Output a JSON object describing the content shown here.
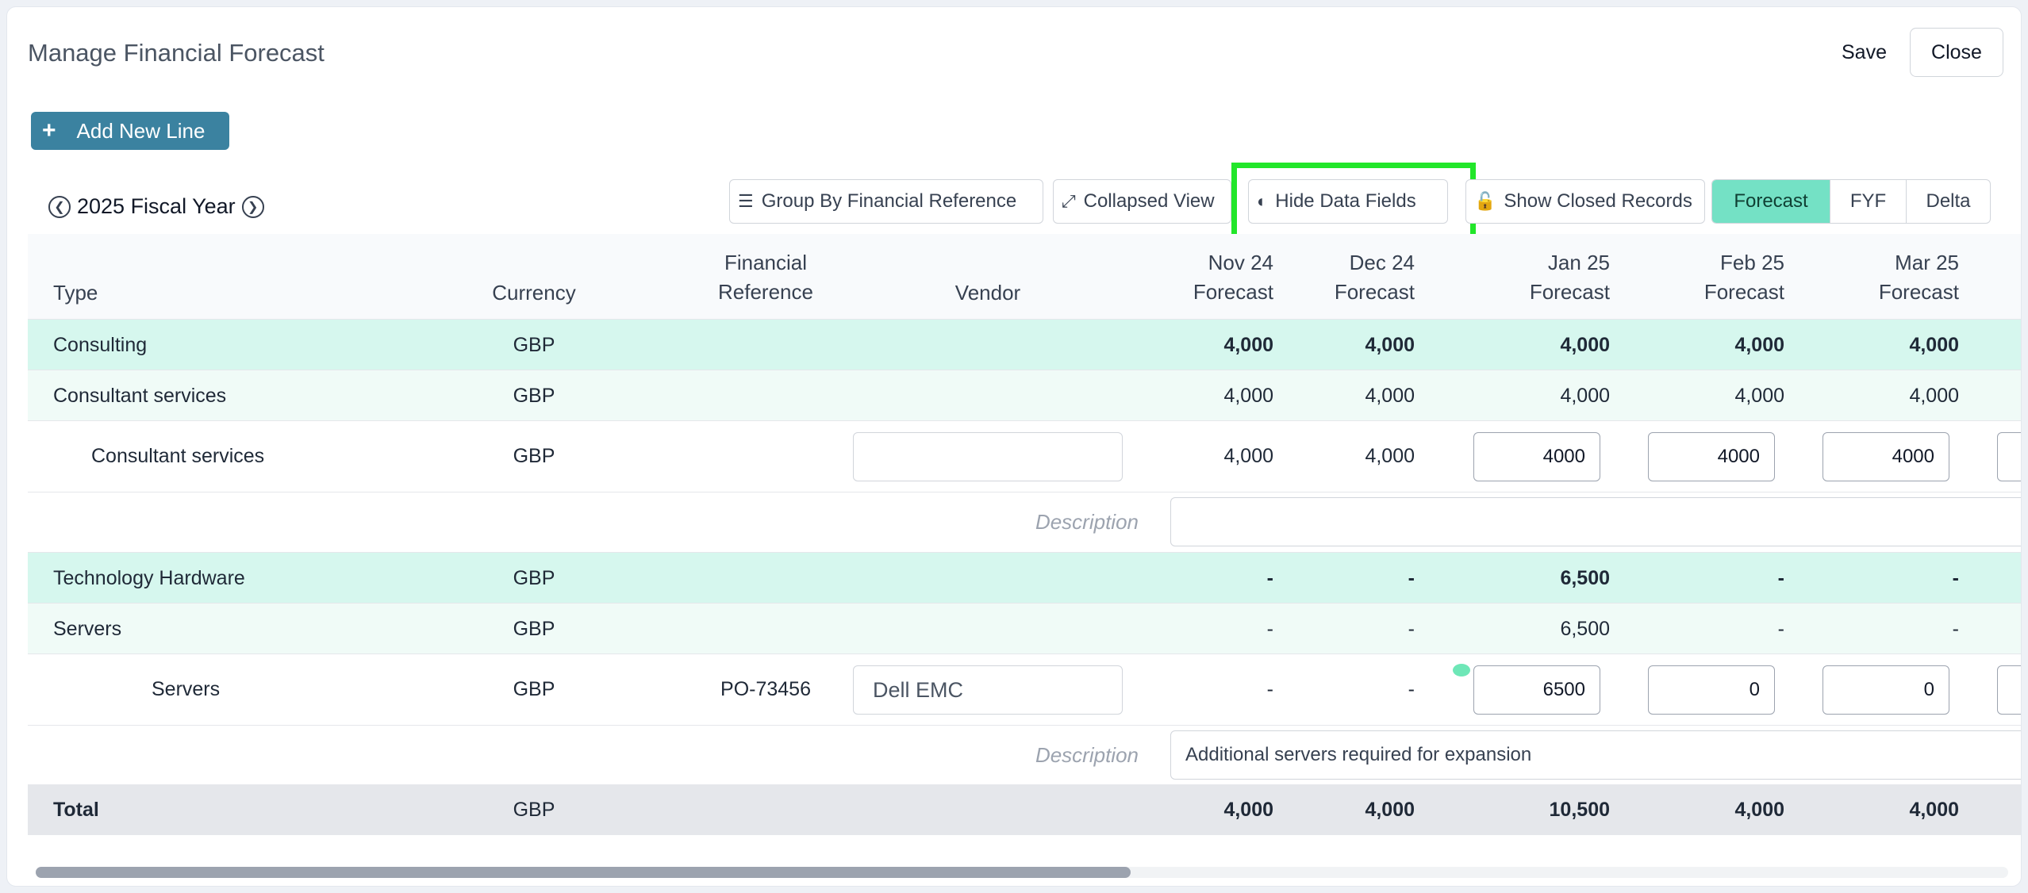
{
  "dialog": {
    "title": "Manage Financial Forecast",
    "save_label": "Save",
    "close_label": "Close"
  },
  "toolbar": {
    "add_line_label": "Add New Line",
    "fiscal_year_label": "2025 Fiscal Year",
    "group_by_label": "Group By Financial Reference",
    "collapsed_view_label": "Collapsed View",
    "hide_fields_label": "Hide Data Fields",
    "show_closed_label": "Show Closed Records",
    "view_modes": [
      "Forecast",
      "FYF",
      "Delta"
    ],
    "active_view": "Forecast"
  },
  "table": {
    "headers": {
      "type": "Type",
      "currency": "Currency",
      "fin_ref_1": "Financial",
      "fin_ref_2": "Reference",
      "vendor": "Vendor",
      "months": [
        {
          "m": "Nov 24",
          "sub": "Forecast"
        },
        {
          "m": "Dec 24",
          "sub": "Forecast"
        },
        {
          "m": "Jan 25",
          "sub": "Forecast"
        },
        {
          "m": "Feb 25",
          "sub": "Forecast"
        },
        {
          "m": "Mar 25",
          "sub": "Forecast"
        }
      ]
    },
    "rows": {
      "consulting": {
        "type": "Consulting",
        "currency": "GBP",
        "v": [
          "4,000",
          "4,000",
          "4,000",
          "4,000",
          "4,000"
        ]
      },
      "consultant_group": {
        "type": "Consultant services",
        "currency": "GBP",
        "v": [
          "4,000",
          "4,000",
          "4,000",
          "4,000",
          "4,000"
        ]
      },
      "consultant_line": {
        "type": "Consultant services",
        "currency": "GBP",
        "vendor": "",
        "v": [
          "4,000",
          "4,000"
        ],
        "inputs": [
          "4000",
          "4000",
          "4000"
        ],
        "description_label": "Description",
        "description": ""
      },
      "hardware": {
        "type": "Technology Hardware",
        "currency": "GBP",
        "v": [
          "-",
          "-",
          "6,500",
          "-",
          "-"
        ]
      },
      "servers_group": {
        "type": "Servers",
        "currency": "GBP",
        "v": [
          "-",
          "-",
          "6,500",
          "-",
          "-"
        ]
      },
      "servers_line": {
        "type": "Servers",
        "currency": "GBP",
        "fin_ref": "PO-73456",
        "vendor": "Dell EMC",
        "v": [
          "-",
          "-"
        ],
        "inputs": [
          "6500",
          "0",
          "0"
        ],
        "description_label": "Description",
        "description": "Additional servers required for expansion"
      },
      "total": {
        "type": "Total",
        "currency": "GBP",
        "v": [
          "4,000",
          "4,000",
          "10,500",
          "4,000",
          "4,000"
        ]
      }
    }
  },
  "colors": {
    "accent": "#3b82a0",
    "highlight": "#22e62a",
    "group_row": "#d6f7ee",
    "active_segment": "#74e1c5"
  }
}
